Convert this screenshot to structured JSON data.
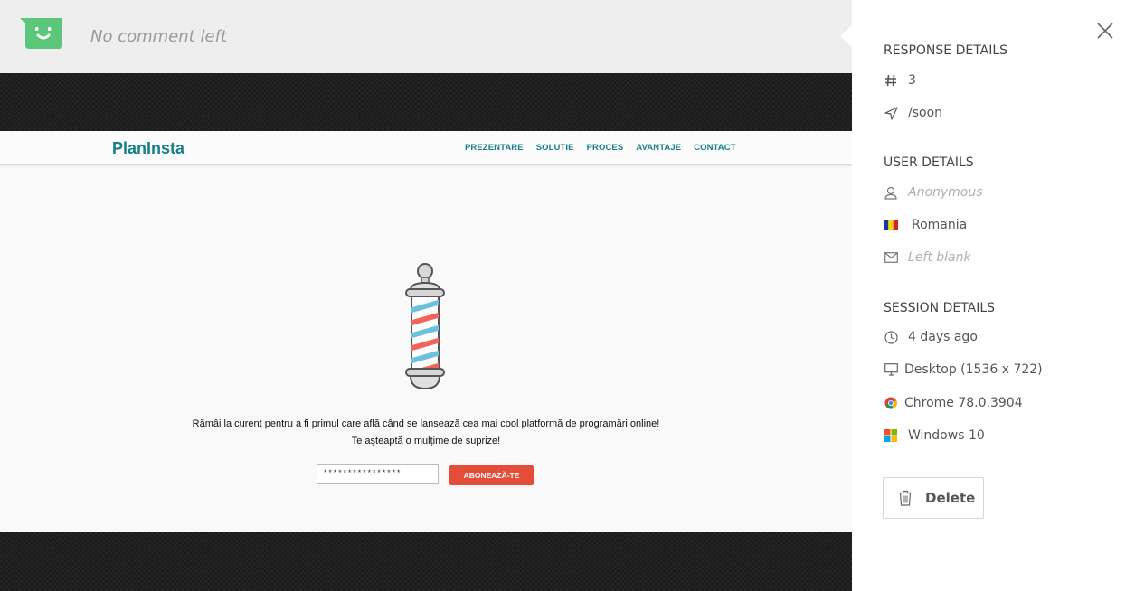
{
  "comment": {
    "text": "No comment left"
  },
  "site": {
    "brand": "PlanInsta",
    "nav": [
      "PREZENTARE",
      "SOLUȚIE",
      "PROCES",
      "AVANTAJE",
      "CONTACT"
    ],
    "message_line1": "Rămâi la curent pentru a fi primul care află când se lansează cea mai cool platformă de programări online!",
    "message_line2": "Te așteaptă o mulțime de suprize!",
    "email_value": "****************",
    "subscribe_label": "ABONEAZĂ-TE"
  },
  "panel": {
    "response_title": "RESPONSE DETAILS",
    "response_number": "3",
    "response_path": "/soon",
    "user_title": "USER DETAILS",
    "user_name": "Anonymous",
    "user_country": "Romania",
    "user_email": "Left blank",
    "session_title": "SESSION DETAILS",
    "session_time": "4 days ago",
    "session_device": "Desktop (1536 x 722)",
    "session_browser": "Chrome 78.0.3904",
    "session_os": "Windows 10",
    "delete_label": "Delete"
  },
  "colors": {
    "accent_green": "#5cc67a",
    "brand_teal": "#167f86",
    "subscribe_red": "#e44d3a"
  },
  "icons": [
    "smiley-face-icon",
    "close-icon",
    "hash-icon",
    "navigation-arrow-icon",
    "user-icon",
    "romania-flag-icon",
    "mail-icon",
    "clock-icon",
    "monitor-icon",
    "chrome-icon",
    "windows-icon",
    "trash-icon",
    "barber-pole-icon"
  ]
}
